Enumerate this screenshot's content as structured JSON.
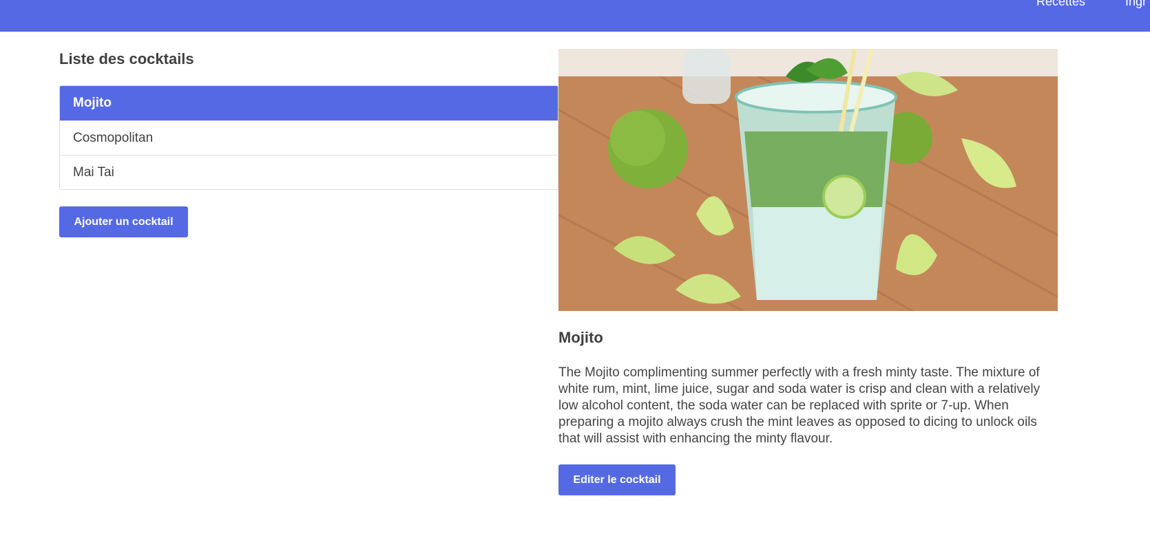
{
  "nav": {
    "recettes": "Recettes",
    "ingredients": "Ingr"
  },
  "list": {
    "title": "Liste des cocktails",
    "items": [
      {
        "label": "Mojito",
        "active": true
      },
      {
        "label": "Cosmopolitan",
        "active": false
      },
      {
        "label": "Mai Tai",
        "active": false
      }
    ],
    "add_button": "Ajouter un cocktail"
  },
  "detail": {
    "image_icon": "cocktail-photo",
    "title": "Mojito",
    "description": "The Mojito complimenting summer perfectly with a fresh minty taste. The mixture of white rum, mint, lime juice, sugar and soda water is crisp and clean with a relatively low alcohol content, the soda water can be replaced with sprite or 7-up. When preparing a mojito always crush the mint leaves as opposed to dicing to unlock oils that will assist with enhancing the minty flavour.",
    "edit_button": "Editer le cocktail"
  },
  "colors": {
    "accent": "#5469e3",
    "text": "#444444",
    "border": "#dcdcdc"
  }
}
